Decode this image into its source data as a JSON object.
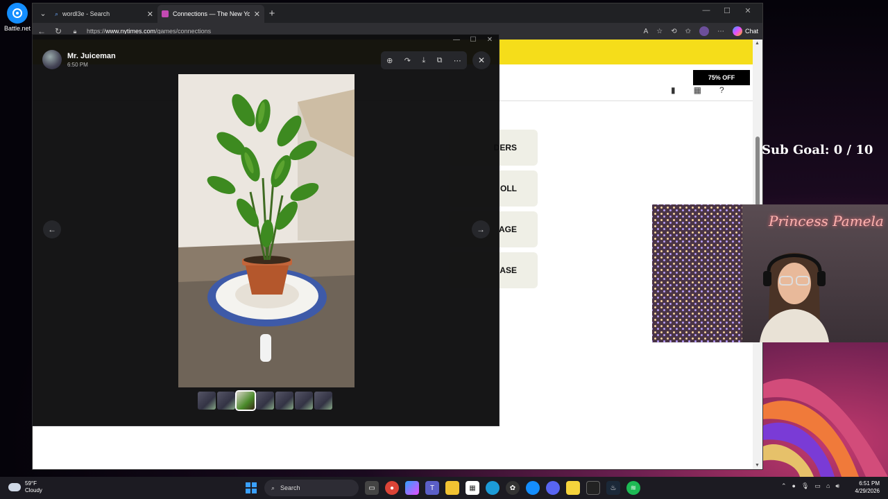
{
  "desktop": {
    "icon_label": "Battle.net"
  },
  "browser": {
    "tabs": [
      {
        "title": "wordl3e - Search",
        "icon": "search-icon"
      },
      {
        "title": "Connections — The New York Tim",
        "icon": "nyt-games-icon"
      }
    ],
    "url_prefix": "https://",
    "url_host": "www.nytimes.com",
    "url_path": "/games/connections",
    "chat_label": "Chat"
  },
  "page": {
    "offer_label": "75% OFF",
    "groups": [
      "DERS",
      "OLL",
      "AGE",
      "ASE"
    ],
    "banner_color": "#f5dd1a"
  },
  "viewer": {
    "author_name": "Mr. Juiceman",
    "author_time": "6:50 PM",
    "thumbnail_count": 7,
    "active_thumbnail": 3
  },
  "stream": {
    "subgoal_text": "Sub Goal: 0 / 10",
    "neon_sign": "Princess Pamela"
  },
  "taskbar": {
    "temperature": "59°F",
    "condition": "Cloudy",
    "search_placeholder": "Search",
    "time": "6:51 PM",
    "date": "4/29/2026"
  }
}
